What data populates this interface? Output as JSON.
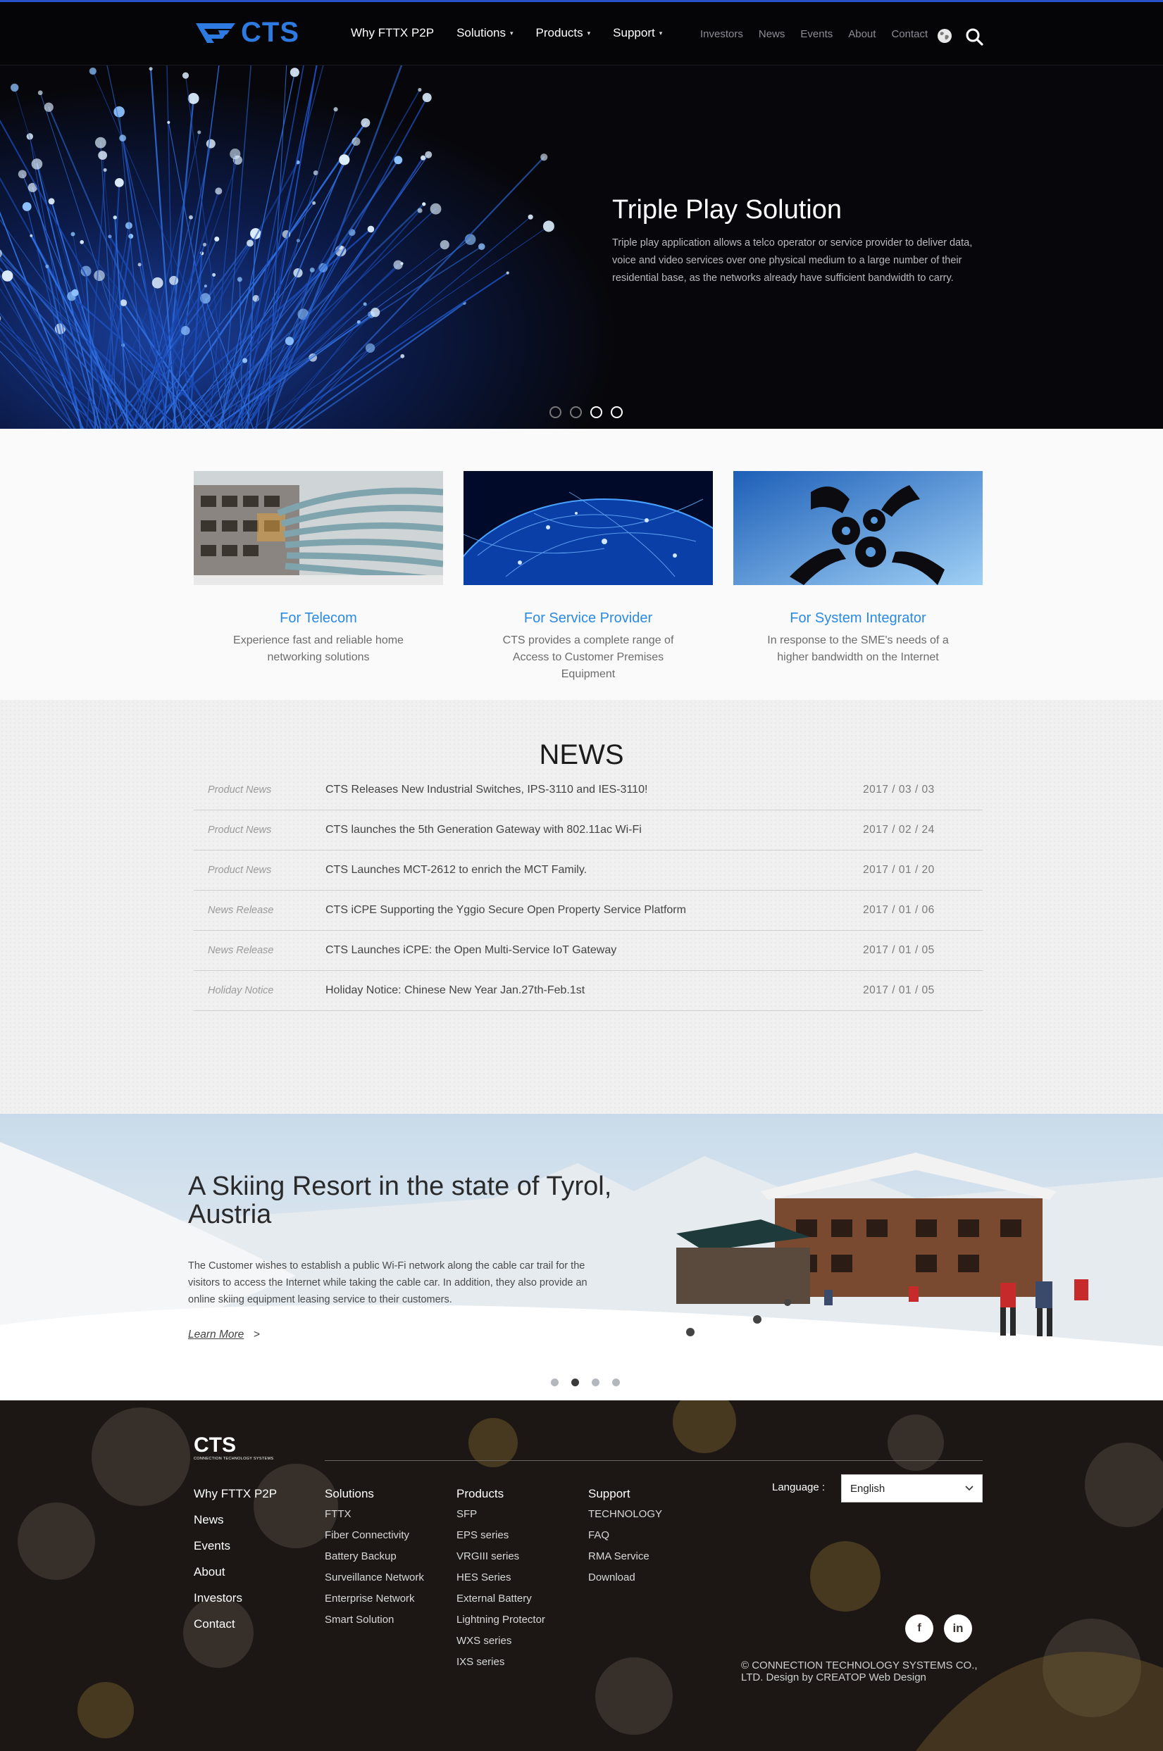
{
  "brand": {
    "name": "CTS",
    "footer_subtitle": "CONNECTION TECHNOLOGY SYSTEMS",
    "accent": "#2d7ae0"
  },
  "header": {
    "main_nav": [
      {
        "label": "Why FTTX P2P",
        "dropdown": false
      },
      {
        "label": "Solutions",
        "dropdown": true
      },
      {
        "label": "Products",
        "dropdown": true
      },
      {
        "label": "Support",
        "dropdown": true
      }
    ],
    "caret": "▾",
    "sub_nav": [
      "Investors",
      "News",
      "Events",
      "About",
      "Contact"
    ],
    "icons": [
      "globe-icon",
      "search-icon"
    ]
  },
  "hero": {
    "title": "Triple Play Solution",
    "text": "Triple play application allows a telco operator or service provider to deliver data, voice and video services over one physical medium to a large number of their residential base, as the networks already have sufficient bandwidth to carry.",
    "slides": 4,
    "active_slide": 3
  },
  "segments": [
    {
      "title": "For Telecom",
      "desc": "Experience fast and reliable home networking solutions"
    },
    {
      "title": "For Service Provider",
      "desc": "CTS provides a complete range of Access to Customer Premises Equipment"
    },
    {
      "title": "For System Integrator",
      "desc": "In response to the SME's needs of a higher bandwidth on the Internet"
    }
  ],
  "news": {
    "title": "NEWS",
    "rows": [
      {
        "category": "Product News",
        "headline": "CTS Releases New Industrial Switches, IPS-3110 and IES-3110!",
        "date": "2017 / 03 / 03"
      },
      {
        "category": "Product News",
        "headline": "CTS launches the 5th Generation Gateway with 802.11ac Wi-Fi",
        "date": "2017 / 02 / 24"
      },
      {
        "category": "Product News",
        "headline": "CTS Launches MCT-2612 to enrich the MCT Family.",
        "date": "2017 / 01 / 20"
      },
      {
        "category": "News Release",
        "headline": "CTS iCPE Supporting the Yggio Secure Open Property Service Platform",
        "date": "2017 / 01 / 06"
      },
      {
        "category": "News Release",
        "headline": "CTS Launches iCPE: the Open Multi-Service IoT Gateway",
        "date": "2017 / 01 / 05"
      },
      {
        "category": "Holiday Notice",
        "headline": "Holiday Notice: Chinese New Year Jan.27th-Feb.1st",
        "date": "2017 / 01 / 05"
      }
    ]
  },
  "case_study": {
    "title": "A Skiing Resort in the state of Tyrol, Austria",
    "text": "The Customer wishes to establish a public Wi-Fi network along the cable car trail for the visitors to access the Internet while taking the cable car. In addition, they also provide an online skiing equipment leasing service to their customers.",
    "learn_more": "Learn More",
    "arrow": ">",
    "slides": 4,
    "active_slide": 2
  },
  "footer": {
    "col1": [
      "Why FTTX P2P",
      "News",
      "Events",
      "About",
      "Investors",
      "Contact"
    ],
    "columns": [
      {
        "heading": "Solutions",
        "links": [
          "FTTX",
          "Fiber Connectivity",
          "Battery Backup",
          "Surveillance Network",
          "Enterprise Network",
          "Smart Solution"
        ]
      },
      {
        "heading": "Products",
        "links": [
          "SFP",
          "EPS series",
          "VRGIII series",
          "HES Series",
          "External Battery",
          "Lightning Protector",
          "WXS series",
          "IXS series"
        ]
      },
      {
        "heading": "Support",
        "links": [
          "TECHNOLOGY",
          "FAQ",
          "RMA Service",
          "Download"
        ]
      }
    ],
    "language_label": "Language :",
    "language_value": "English",
    "social": [
      {
        "name": "facebook-icon",
        "glyph": "f"
      },
      {
        "name": "linkedin-icon",
        "glyph": "in"
      }
    ],
    "copyright": "© CONNECTION TECHNOLOGY SYSTEMS CO., LTD. Design by CREATOP Web Design"
  }
}
